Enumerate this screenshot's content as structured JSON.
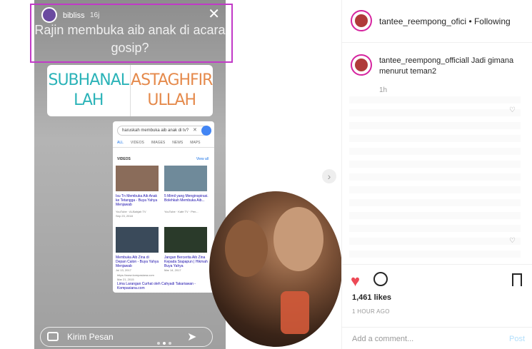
{
  "story": {
    "username": "bibliss",
    "time": "16j",
    "question": "Rajin membuka aib anak di acara gosip?",
    "poll_options": [
      "SUBHANAL LAH",
      "ASTAGHFIR ULLAH"
    ],
    "message_placeholder": "Kirim Pesan",
    "search": {
      "query": "haruskah membuka aib anak di tv?",
      "tabs": [
        "ALL",
        "VIDEOS",
        "IMAGES",
        "NEWS",
        "MAPS"
      ],
      "videos_header": "VIDEOS",
      "view_all": "View all",
      "videos": [
        {
          "title": "Isu Tn Membuka Aib Anak ke Tetangga - Buya Yahya Menjawab",
          "source": "YouTube · Al-Bahjah TV",
          "date": "Sep 23, 2018"
        },
        {
          "title": "5 Mimil yang Menginspirasi. Bolehkah Membuka Aib...",
          "source": "YouTube · Kafe TV · Pen...",
          "date": ""
        },
        {
          "title": "Membuka Aib Zina di Depan Calon - Buya Yahya Menjawab",
          "source": "YouTube · Al-Bahjah TV",
          "date": "Jul 13, 2017"
        },
        {
          "title": "Jangan Bercerita Aib Zina Kepada Siapapun | Hikmah Buya Yahya",
          "source": "YouTube · Al-Bahjah TV",
          "date": "Mar 14, 2017"
        }
      ],
      "result_url": "https://www.kompasiana.com",
      "result_date": "Mar 21, 2015",
      "result_title": "Lima Larangan Curhat oleh Cahyadi Takariawan - Kompasiana.com"
    }
  },
  "post": {
    "account": "tantee_reempong_ofici",
    "following": "• Following",
    "comment_user": "tantee_reempong_officiall",
    "comment_text": "Jadi gimana menurut teman2",
    "comment_time": "1h",
    "likes": "1,461 likes",
    "ago": "1 HOUR AGO",
    "add_comment": "Add a comment...",
    "post_button": "Post"
  },
  "colors": {
    "highlight": "#c13ac7",
    "like": "#ed4956",
    "poll_a": "#2bb3b8",
    "poll_b": "#e58a4c"
  }
}
